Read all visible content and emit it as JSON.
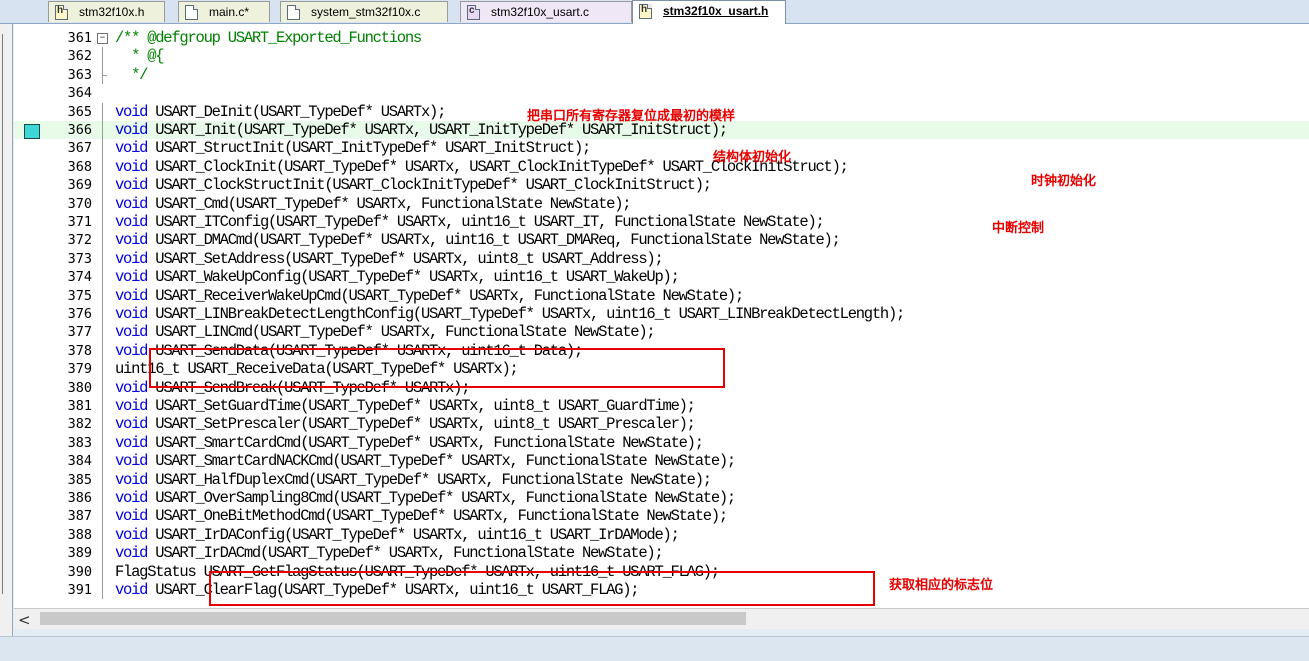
{
  "tabs": [
    {
      "label": "stm32f10x.h",
      "type": "h",
      "active": false
    },
    {
      "label": "main.c*",
      "type": "c",
      "active": false
    },
    {
      "label": "system_stm32f10x.c",
      "type": "c",
      "active": false
    },
    {
      "label": "stm32f10x_usart.c",
      "type": "h",
      "active": false
    },
    {
      "label": "stm32f10x_usart.h",
      "type": "h",
      "active": true
    }
  ],
  "lines": [
    {
      "num": "361",
      "text": "/** @defgroup USART_Exported_Functions"
    },
    {
      "num": "362",
      "text": "  * @{"
    },
    {
      "num": "363",
      "text": "  */"
    },
    {
      "num": "364",
      "text": ""
    },
    {
      "num": "365",
      "text": "void USART_DeInit(USART_TypeDef* USARTx);"
    },
    {
      "num": "366",
      "text": "void USART_Init(USART_TypeDef* USARTx, USART_InitTypeDef* USART_InitStruct);"
    },
    {
      "num": "367",
      "text": "void USART_StructInit(USART_InitTypeDef* USART_InitStruct);"
    },
    {
      "num": "368",
      "text": "void USART_ClockInit(USART_TypeDef* USARTx, USART_ClockInitTypeDef* USART_ClockInitStruct);"
    },
    {
      "num": "369",
      "text": "void USART_ClockStructInit(USART_ClockInitTypeDef* USART_ClockInitStruct);"
    },
    {
      "num": "370",
      "text": "void USART_Cmd(USART_TypeDef* USARTx, FunctionalState NewState);"
    },
    {
      "num": "371",
      "text": "void USART_ITConfig(USART_TypeDef* USARTx, uint16_t USART_IT, FunctionalState NewState);"
    },
    {
      "num": "372",
      "text": "void USART_DMACmd(USART_TypeDef* USARTx, uint16_t USART_DMAReq, FunctionalState NewState);"
    },
    {
      "num": "373",
      "text": "void USART_SetAddress(USART_TypeDef* USARTx, uint8_t USART_Address);"
    },
    {
      "num": "374",
      "text": "void USART_WakeUpConfig(USART_TypeDef* USARTx, uint16_t USART_WakeUp);"
    },
    {
      "num": "375",
      "text": "void USART_ReceiverWakeUpCmd(USART_TypeDef* USARTx, FunctionalState NewState);"
    },
    {
      "num": "376",
      "text": "void USART_LINBreakDetectLengthConfig(USART_TypeDef* USARTx, uint16_t USART_LINBreakDetectLength);"
    },
    {
      "num": "377",
      "text": "void USART_LINCmd(USART_TypeDef* USARTx, FunctionalState NewState);"
    },
    {
      "num": "378",
      "text": "void USART_SendData(USART_TypeDef* USARTx, uint16_t Data);"
    },
    {
      "num": "379",
      "text": "uint16_t USART_ReceiveData(USART_TypeDef* USARTx);"
    },
    {
      "num": "380",
      "text": "void USART_SendBreak(USART_TypeDef* USARTx);"
    },
    {
      "num": "381",
      "text": "void USART_SetGuardTime(USART_TypeDef* USARTx, uint8_t USART_GuardTime);"
    },
    {
      "num": "382",
      "text": "void USART_SetPrescaler(USART_TypeDef* USARTx, uint8_t USART_Prescaler);"
    },
    {
      "num": "383",
      "text": "void USART_SmartCardCmd(USART_TypeDef* USARTx, FunctionalState NewState);"
    },
    {
      "num": "384",
      "text": "void USART_SmartCardNACKCmd(USART_TypeDef* USARTx, FunctionalState NewState);"
    },
    {
      "num": "385",
      "text": "void USART_HalfDuplexCmd(USART_TypeDef* USARTx, FunctionalState NewState);"
    },
    {
      "num": "386",
      "text": "void USART_OverSampling8Cmd(USART_TypeDef* USARTx, FunctionalState NewState);"
    },
    {
      "num": "387",
      "text": "void USART_OneBitMethodCmd(USART_TypeDef* USARTx, FunctionalState NewState);"
    },
    {
      "num": "388",
      "text": "void USART_IrDAConfig(USART_TypeDef* USARTx, uint16_t USART_IrDAMode);"
    },
    {
      "num": "389",
      "text": "void USART_IrDACmd(USART_TypeDef* USARTx, FunctionalState NewState);"
    },
    {
      "num": "390",
      "text": "FlagStatus USART_GetFlagStatus(USART_TypeDef* USARTx, uint16_t USART_FLAG);"
    },
    {
      "num": "391",
      "text": "void USART_ClearFlag(USART_TypeDef* USARTx, uint16_t USART_FLAG);"
    }
  ],
  "notes": {
    "deinit": "把串口所有寄存器复位成最初的模样",
    "structinit": "结构体初始化",
    "clockinit": "时钟初始化",
    "itconfig": "中断控制",
    "getflag": "获取相应的标志位"
  },
  "colors": {
    "keyword": "#0000e0",
    "comment": "#008000",
    "annotation": "#e60000",
    "current_line": "#e8fbe8",
    "bookmark": "#3ed7d7"
  },
  "icons": {
    "scroll_left": "<"
  }
}
